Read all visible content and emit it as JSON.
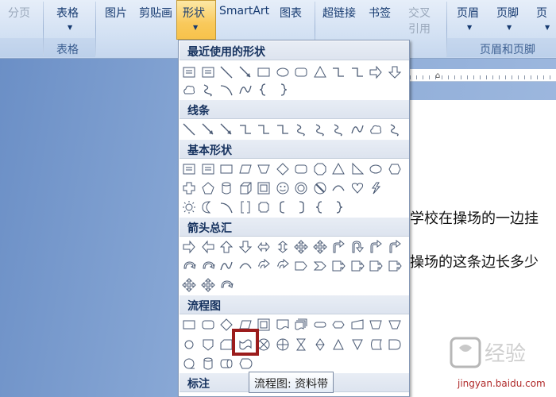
{
  "ribbon": {
    "buttons": {
      "cover_page": "分页",
      "table": "表格",
      "picture": "图片",
      "clipart": "剪贴画",
      "shapes": "形状",
      "smartart": "SmartArt",
      "chart": "图表",
      "hyperlink": "超链接",
      "bookmark": "书签",
      "cross_ref_line1": "交叉",
      "cross_ref_line2": "引用",
      "header": "页眉",
      "footer": "页脚",
      "page_number": "页"
    },
    "groups": {
      "tables": "表格",
      "header_footer": "页眉和页脚"
    }
  },
  "shapes_menu": {
    "sections": {
      "recent": "最近使用的形状",
      "lines": "线条",
      "basic": "基本形状",
      "arrows": "箭头总汇",
      "flowchart": "流程图",
      "callouts": "标注"
    },
    "selected_shape": "flowchart-punched-tape"
  },
  "tooltip": {
    "text": "流程图: 资料带"
  },
  "document": {
    "line1": "学校在操场的一边挂",
    "line2": "操场的这条边长多少"
  },
  "watermark": {
    "text": "jingyan.baidu.com"
  },
  "colors": {
    "highlight_border": "#9b1c1c",
    "ribbon_text": "#163a70",
    "selected_button": "#f9c95b"
  }
}
